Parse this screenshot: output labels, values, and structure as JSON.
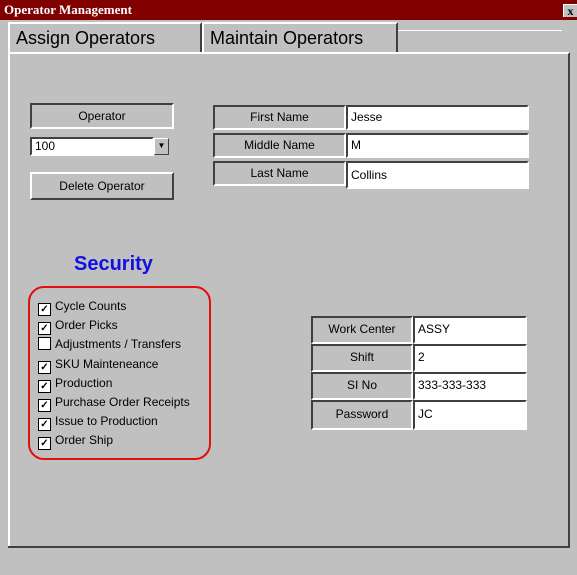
{
  "window": {
    "title": "Operator Management",
    "close_label": "x"
  },
  "tabs": [
    {
      "label": "Assign Operators",
      "active": false
    },
    {
      "label": "Maintain Operators",
      "active": true
    }
  ],
  "operator": {
    "label": "Operator",
    "value": "100",
    "delete_label": "Delete Operator"
  },
  "name": {
    "first_label": "First Name",
    "first_value": "Jesse",
    "middle_label": "Middle Name",
    "middle_value": "M",
    "last_label": "Last Name",
    "last_value": "Collins"
  },
  "security": {
    "title": "Security",
    "title_color": "#1010e0",
    "outline_color": "#e01010",
    "items": [
      {
        "label": "Cycle Counts",
        "checked": true
      },
      {
        "label": "Order Picks",
        "checked": true
      },
      {
        "label": "Adjustments / Transfers",
        "checked": false
      },
      {
        "label": "SKU Mainteneance",
        "checked": true
      },
      {
        "label": "Production",
        "checked": true
      },
      {
        "label": "Purchase Order Receipts",
        "checked": true
      },
      {
        "label": "Issue to Production",
        "checked": true
      },
      {
        "label": "Order Ship",
        "checked": true
      }
    ]
  },
  "details": {
    "workcenter_label": "Work Center",
    "workcenter_value": "ASSY",
    "shift_label": "Shift",
    "shift_value": "2",
    "sino_label": "SI No",
    "sino_value": "333-333-333",
    "password_label": "Password",
    "password_value": "JC"
  },
  "colors": {
    "title_bar": "#800000",
    "face": "#c0c0c0"
  }
}
